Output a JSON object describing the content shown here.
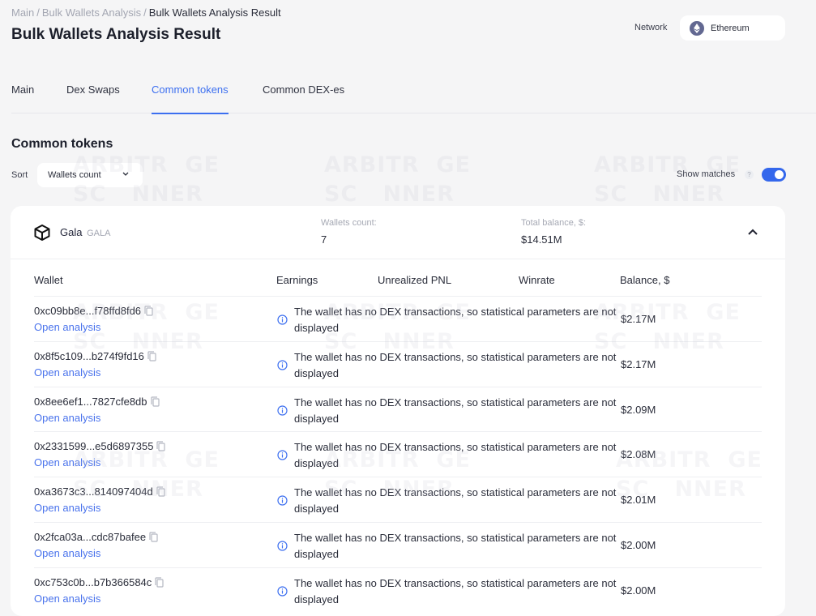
{
  "breadcrumb": [
    {
      "label": "Main"
    },
    {
      "label": "Bulk Wallets Analysis"
    },
    {
      "label": "Bulk Wallets Analysis Result"
    }
  ],
  "page_title": "Bulk Wallets Analysis Result",
  "network": {
    "label": "Network",
    "value": "Ethereum",
    "icon": "ethereum-icon"
  },
  "tabs": [
    {
      "label": "Main",
      "active": false
    },
    {
      "label": "Dex Swaps",
      "active": false
    },
    {
      "label": "Common tokens",
      "active": true
    },
    {
      "label": "Common DEX-es",
      "active": false
    }
  ],
  "section": {
    "title": "Common tokens",
    "sort_label": "Sort",
    "sort_value": "Wallets count",
    "show_matches_label": "Show matches",
    "show_matches_help": "?",
    "show_matches_enabled": true
  },
  "watermark": {
    "line1": "ARBITR  GE",
    "line2": "SC   NNER"
  },
  "token": {
    "name": "Gala",
    "symbol": "GALA",
    "wallets_count_label": "Wallets count:",
    "wallets_count": "7",
    "total_balance_label": "Total balance, $:",
    "total_balance": "$14.51M",
    "expanded": true
  },
  "table": {
    "columns": [
      "Wallet",
      "Earnings",
      "Unrealized PNL",
      "Winrate",
      "Balance, $"
    ],
    "open_label": "Open analysis",
    "notice": "The wallet has no DEX transactions, so statistical parameters are not displayed",
    "rows": [
      {
        "wallet": "0xc09bb8e...f78ffd8fd6",
        "balance": "$2.17M"
      },
      {
        "wallet": "0x8f5c109...b274f9fd16",
        "balance": "$2.17M"
      },
      {
        "wallet": "0x8ee6ef1...7827cfe8db",
        "balance": "$2.09M"
      },
      {
        "wallet": "0x2331599...e5d6897355",
        "balance": "$2.08M"
      },
      {
        "wallet": "0xa3673c3...814097404d",
        "balance": "$2.01M"
      },
      {
        "wallet": "0x2fca03a...cdc87bafee",
        "balance": "$2.00M"
      },
      {
        "wallet": "0xc753c0b...b7b366584c",
        "balance": "$2.00M"
      }
    ]
  },
  "colors": {
    "accent": "#3c6ff0",
    "link": "#4a73ec",
    "background": "#f5f5f6"
  }
}
